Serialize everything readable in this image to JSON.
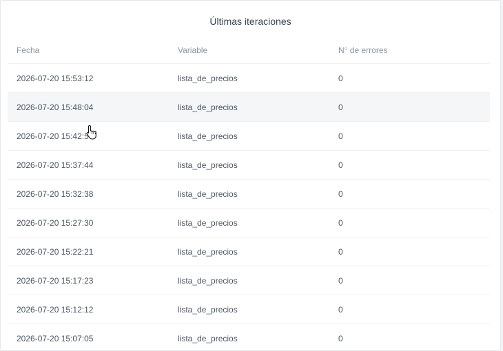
{
  "panel": {
    "title": "Últimas iteraciones"
  },
  "table": {
    "columns": [
      "Fecha",
      "Variable",
      "N° de errores"
    ],
    "rows": [
      [
        "2026-07-20 15:53:12",
        "lista_de_precios",
        "0"
      ],
      [
        "2026-07-20 15:48:04",
        "lista_de_precios",
        "0"
      ],
      [
        "2026-07-20 15:42:5",
        "lista_de_precios",
        "0"
      ],
      [
        "2026-07-20 15:37:44",
        "lista_de_precios",
        "0"
      ],
      [
        "2026-07-20 15:32:38",
        "lista_de_precios",
        "0"
      ],
      [
        "2026-07-20 15:27:30",
        "lista_de_precios",
        "0"
      ],
      [
        "2026-07-20 15:22:21",
        "lista_de_precios",
        "0"
      ],
      [
        "2026-07-20 15:17:23",
        "lista_de_precios",
        "0"
      ],
      [
        "2026-07-20 15:12:12",
        "lista_de_precios",
        "0"
      ],
      [
        "2026-07-20 15:07:05",
        "lista_de_precios",
        "0"
      ]
    ],
    "highlighted_row": 1
  },
  "cursor": {
    "icon": "hand-pointer-icon"
  }
}
